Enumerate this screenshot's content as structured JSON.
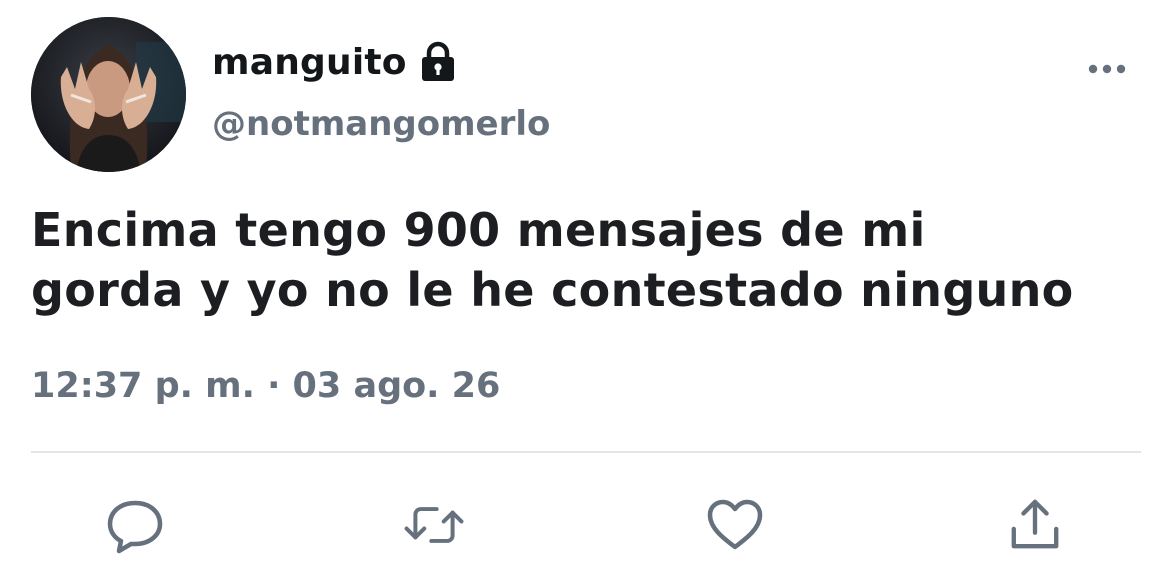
{
  "user": {
    "display_name": "manguito",
    "handle": "@notmangomerlo",
    "protected": true,
    "lock_icon": "lock-icon",
    "avatar_icon": "profile-avatar"
  },
  "tweet": {
    "text_lines": [
      "Encima tengo 900 mensajes de mi",
      "gorda y yo no le he contestado ninguno"
    ],
    "timestamp": "12:37 p. m. · 03 ago. 26"
  },
  "actions": {
    "more_icon": "more-dots-icon",
    "reply_icon": "reply-icon",
    "retweet_icon": "retweet-icon",
    "like_icon": "heart-icon",
    "share_icon": "share-icon"
  },
  "colors": {
    "text_primary": "#14171a",
    "text_secondary": "#66717d",
    "divider": "#e3e6e9",
    "background": "#ffffff"
  }
}
